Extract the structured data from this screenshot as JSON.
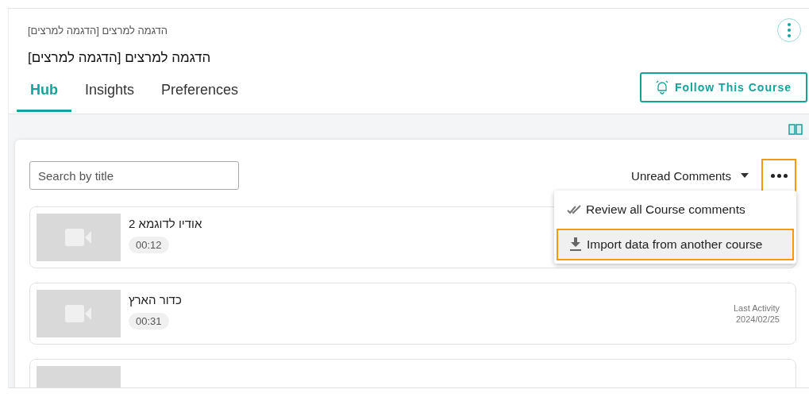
{
  "breadcrumb": "הדגמה למרצים [הדגמה למרצים]",
  "title": "הדגמה למרצים [הדגמה למרצים]",
  "tabs": [
    {
      "label": "Hub",
      "selected": true
    },
    {
      "label": "Insights",
      "selected": false
    },
    {
      "label": "Preferences",
      "selected": false
    }
  ],
  "follow_button": "Follow This Course",
  "search": {
    "placeholder": "Search by title"
  },
  "sort": {
    "value": "Unread Comments"
  },
  "more_button": {
    "highlighted": true
  },
  "menu": [
    {
      "label": "Review all Course comments",
      "kind": "review",
      "highlighted": false
    },
    {
      "label": "Import data from another course",
      "kind": "import",
      "highlighted": true
    }
  ],
  "items": [
    {
      "title": "אודיו לדוגמא 2",
      "duration": "00:12"
    },
    {
      "title": "כדור הארץ",
      "duration": "00:31",
      "activity_label": "Last Activity",
      "activity_date": "2024/02/25"
    },
    {
      "kind": "partial"
    }
  ]
}
